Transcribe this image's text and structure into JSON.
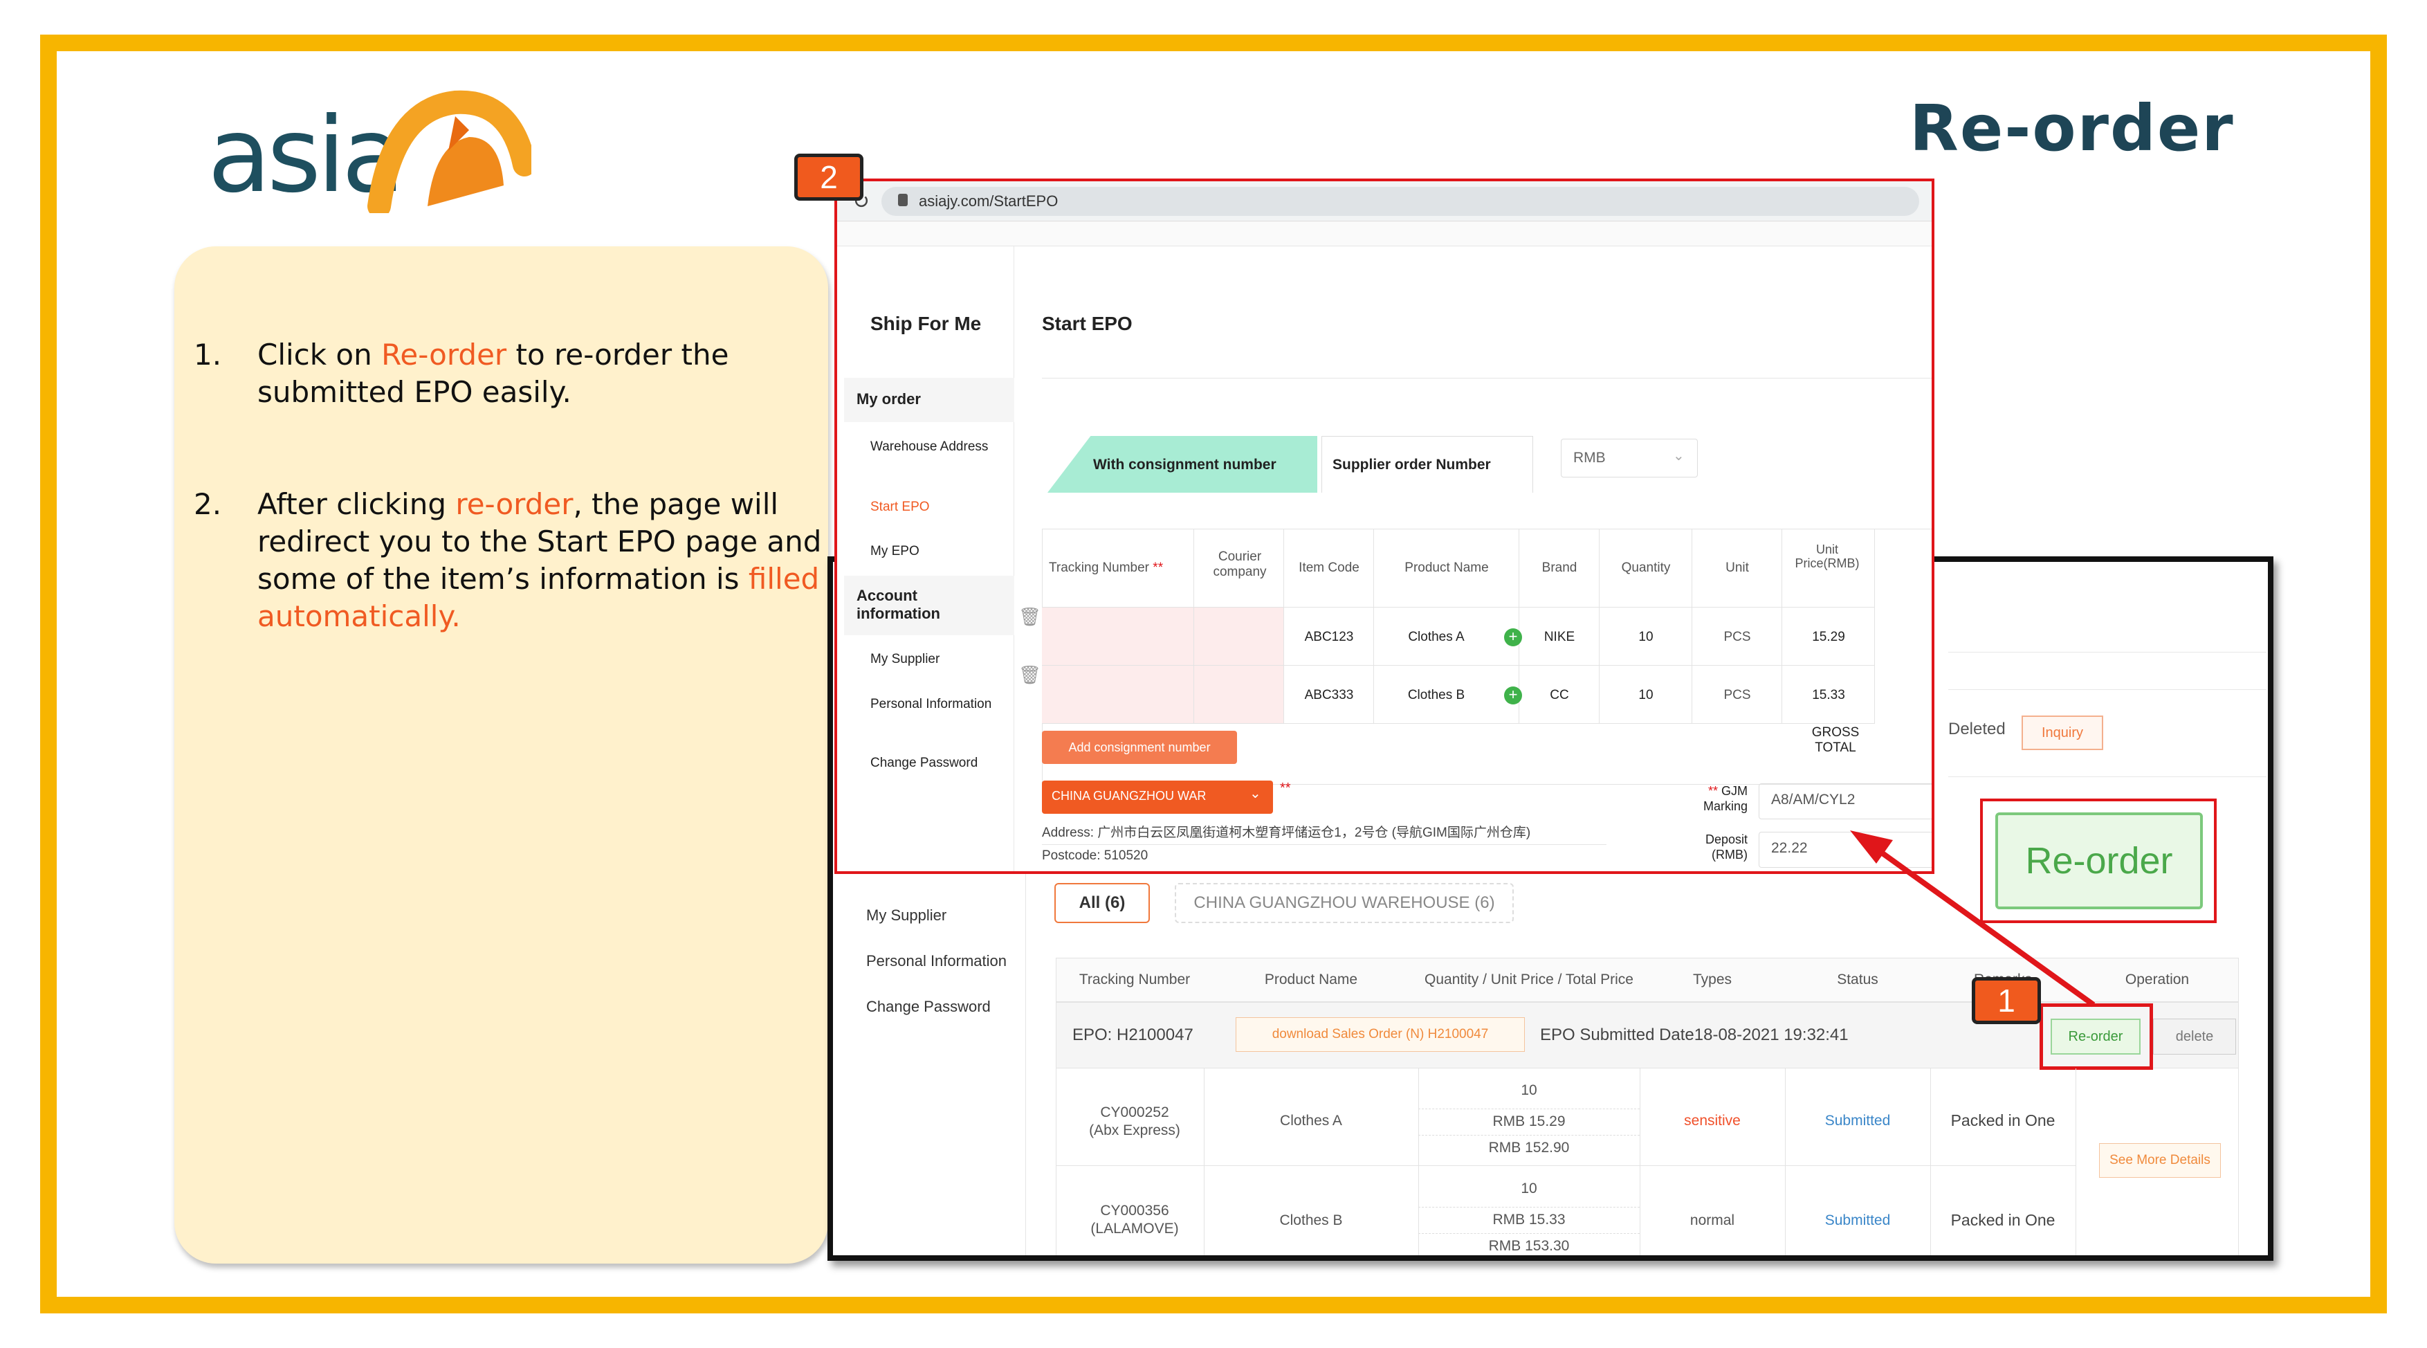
{
  "logo": {
    "text": "asia"
  },
  "page_title": "Re-order",
  "instructions": [
    {
      "num": "1.",
      "parts": [
        {
          "t": "Click on ",
          "hl": false
        },
        {
          "t": "Re-order",
          "hl": true
        },
        {
          "t": " to re-order the submitted EPO easily.",
          "hl": false
        }
      ]
    },
    {
      "num": "2.",
      "parts": [
        {
          "t": "After clicking ",
          "hl": false
        },
        {
          "t": "re-order",
          "hl": true
        },
        {
          "t": ", the page will redirect you to the Start EPO page and some of the item’s information is ",
          "hl": false
        },
        {
          "t": "filled automatically.",
          "hl": true
        }
      ]
    }
  ],
  "badges": {
    "one": "1",
    "two": "2"
  },
  "front": {
    "url": "asiajy.com/StartEPO",
    "sidebar_title": "Ship For Me",
    "page_heading": "Start EPO",
    "sidebar": {
      "my_order": "My order",
      "warehouse_address": "Warehouse Address",
      "start_epo": "Start EPO",
      "my_epo": "My EPO",
      "account_info": "Account information",
      "my_supplier": "My Supplier",
      "personal_info": "Personal Information",
      "change_password": "Change Password"
    },
    "tab_consignment": "With consignment number",
    "tab_supplier": "Supplier order Number",
    "currency": "RMB",
    "columns": [
      "Tracking Number",
      "Courier company",
      "Item Code",
      "Product Name",
      "Brand",
      "Quantity",
      "Unit",
      "Unit Price(RMB)"
    ],
    "rows": [
      {
        "item_code": "ABC123",
        "product": "Clothes A",
        "brand": "NIKE",
        "qty": "10",
        "unit": "PCS",
        "price": "15.29"
      },
      {
        "item_code": "ABC333",
        "product": "Clothes B",
        "brand": "CC",
        "qty": "10",
        "unit": "PCS",
        "price": "15.33"
      }
    ],
    "add_consignment": "Add consignment number",
    "gross_total": "GROSS TOTAL",
    "warehouse_select": "CHINA GUANGZHOU WAR",
    "gjm_label": "GJM Marking",
    "gjm_value": "A8/AM/CYL2",
    "deposit_label": "Deposit (RMB)",
    "deposit_value": "22.22",
    "address": "Address: 广州市白云区凤凰街道柯木塑育坪储运仓1，2号仓 (导航GIM国际广州仓库)",
    "postcode": "Postcode: 510520"
  },
  "back": {
    "deleted": "Deleted",
    "inquiry": "Inquiry",
    "reorder_big": "Re-order",
    "sidebar": {
      "my_supplier": "My Supplier",
      "personal_info": "Personal Information",
      "change_password": "Change Password"
    },
    "tab_all": "All (6)",
    "tab_warehouse": "CHINA GUANGZHOU WAREHOUSE (6)",
    "columns": [
      "Tracking Number",
      "Product Name",
      "Quantity / Unit Price / Total Price",
      "Types",
      "Status",
      "Remarks",
      "Operation"
    ],
    "epo_no": "EPO: H2100047",
    "download": "download Sales Order (N) H2100047",
    "submitted": "EPO Submitted Date18-08-2021 19:32:41",
    "reorder": "Re-order",
    "delete": "delete",
    "see_more": "See More Details",
    "rows": [
      {
        "tracking": "CY000252",
        "courier": "(Abx Express)",
        "product": "Clothes A",
        "qty": "10",
        "unit_price": "RMB  15.29",
        "total": "RMB  152.90",
        "type": "sensitive",
        "status": "Submitted",
        "remark": "Packed in One"
      },
      {
        "tracking": "CY000356",
        "courier": "(LALAMOVE)",
        "product": "Clothes B",
        "qty": "10",
        "unit_price": "RMB  15.33",
        "total": "RMB  153.30",
        "type": "normal",
        "status": "Submitted",
        "remark": "Packed in One"
      }
    ]
  },
  "colors": {
    "accent": "#f05a22",
    "frame": "#f7b500",
    "title": "#1e4556",
    "callout": "#e0161a"
  }
}
